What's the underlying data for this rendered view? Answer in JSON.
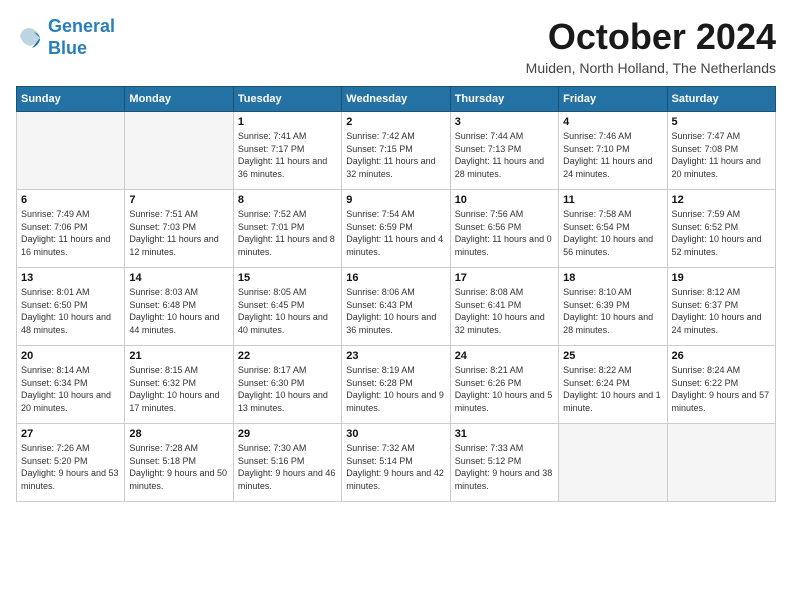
{
  "header": {
    "logo_line1": "General",
    "logo_line2": "Blue",
    "month_title": "October 2024",
    "location": "Muiden, North Holland, The Netherlands"
  },
  "weekdays": [
    "Sunday",
    "Monday",
    "Tuesday",
    "Wednesday",
    "Thursday",
    "Friday",
    "Saturday"
  ],
  "weeks": [
    [
      {
        "day": "",
        "info": ""
      },
      {
        "day": "",
        "info": ""
      },
      {
        "day": "1",
        "info": "Sunrise: 7:41 AM\nSunset: 7:17 PM\nDaylight: 11 hours and 36 minutes."
      },
      {
        "day": "2",
        "info": "Sunrise: 7:42 AM\nSunset: 7:15 PM\nDaylight: 11 hours and 32 minutes."
      },
      {
        "day": "3",
        "info": "Sunrise: 7:44 AM\nSunset: 7:13 PM\nDaylight: 11 hours and 28 minutes."
      },
      {
        "day": "4",
        "info": "Sunrise: 7:46 AM\nSunset: 7:10 PM\nDaylight: 11 hours and 24 minutes."
      },
      {
        "day": "5",
        "info": "Sunrise: 7:47 AM\nSunset: 7:08 PM\nDaylight: 11 hours and 20 minutes."
      }
    ],
    [
      {
        "day": "6",
        "info": "Sunrise: 7:49 AM\nSunset: 7:06 PM\nDaylight: 11 hours and 16 minutes."
      },
      {
        "day": "7",
        "info": "Sunrise: 7:51 AM\nSunset: 7:03 PM\nDaylight: 11 hours and 12 minutes."
      },
      {
        "day": "8",
        "info": "Sunrise: 7:52 AM\nSunset: 7:01 PM\nDaylight: 11 hours and 8 minutes."
      },
      {
        "day": "9",
        "info": "Sunrise: 7:54 AM\nSunset: 6:59 PM\nDaylight: 11 hours and 4 minutes."
      },
      {
        "day": "10",
        "info": "Sunrise: 7:56 AM\nSunset: 6:56 PM\nDaylight: 11 hours and 0 minutes."
      },
      {
        "day": "11",
        "info": "Sunrise: 7:58 AM\nSunset: 6:54 PM\nDaylight: 10 hours and 56 minutes."
      },
      {
        "day": "12",
        "info": "Sunrise: 7:59 AM\nSunset: 6:52 PM\nDaylight: 10 hours and 52 minutes."
      }
    ],
    [
      {
        "day": "13",
        "info": "Sunrise: 8:01 AM\nSunset: 6:50 PM\nDaylight: 10 hours and 48 minutes."
      },
      {
        "day": "14",
        "info": "Sunrise: 8:03 AM\nSunset: 6:48 PM\nDaylight: 10 hours and 44 minutes."
      },
      {
        "day": "15",
        "info": "Sunrise: 8:05 AM\nSunset: 6:45 PM\nDaylight: 10 hours and 40 minutes."
      },
      {
        "day": "16",
        "info": "Sunrise: 8:06 AM\nSunset: 6:43 PM\nDaylight: 10 hours and 36 minutes."
      },
      {
        "day": "17",
        "info": "Sunrise: 8:08 AM\nSunset: 6:41 PM\nDaylight: 10 hours and 32 minutes."
      },
      {
        "day": "18",
        "info": "Sunrise: 8:10 AM\nSunset: 6:39 PM\nDaylight: 10 hours and 28 minutes."
      },
      {
        "day": "19",
        "info": "Sunrise: 8:12 AM\nSunset: 6:37 PM\nDaylight: 10 hours and 24 minutes."
      }
    ],
    [
      {
        "day": "20",
        "info": "Sunrise: 8:14 AM\nSunset: 6:34 PM\nDaylight: 10 hours and 20 minutes."
      },
      {
        "day": "21",
        "info": "Sunrise: 8:15 AM\nSunset: 6:32 PM\nDaylight: 10 hours and 17 minutes."
      },
      {
        "day": "22",
        "info": "Sunrise: 8:17 AM\nSunset: 6:30 PM\nDaylight: 10 hours and 13 minutes."
      },
      {
        "day": "23",
        "info": "Sunrise: 8:19 AM\nSunset: 6:28 PM\nDaylight: 10 hours and 9 minutes."
      },
      {
        "day": "24",
        "info": "Sunrise: 8:21 AM\nSunset: 6:26 PM\nDaylight: 10 hours and 5 minutes."
      },
      {
        "day": "25",
        "info": "Sunrise: 8:22 AM\nSunset: 6:24 PM\nDaylight: 10 hours and 1 minute."
      },
      {
        "day": "26",
        "info": "Sunrise: 8:24 AM\nSunset: 6:22 PM\nDaylight: 9 hours and 57 minutes."
      }
    ],
    [
      {
        "day": "27",
        "info": "Sunrise: 7:26 AM\nSunset: 5:20 PM\nDaylight: 9 hours and 53 minutes."
      },
      {
        "day": "28",
        "info": "Sunrise: 7:28 AM\nSunset: 5:18 PM\nDaylight: 9 hours and 50 minutes."
      },
      {
        "day": "29",
        "info": "Sunrise: 7:30 AM\nSunset: 5:16 PM\nDaylight: 9 hours and 46 minutes."
      },
      {
        "day": "30",
        "info": "Sunrise: 7:32 AM\nSunset: 5:14 PM\nDaylight: 9 hours and 42 minutes."
      },
      {
        "day": "31",
        "info": "Sunrise: 7:33 AM\nSunset: 5:12 PM\nDaylight: 9 hours and 38 minutes."
      },
      {
        "day": "",
        "info": ""
      },
      {
        "day": "",
        "info": ""
      }
    ]
  ]
}
